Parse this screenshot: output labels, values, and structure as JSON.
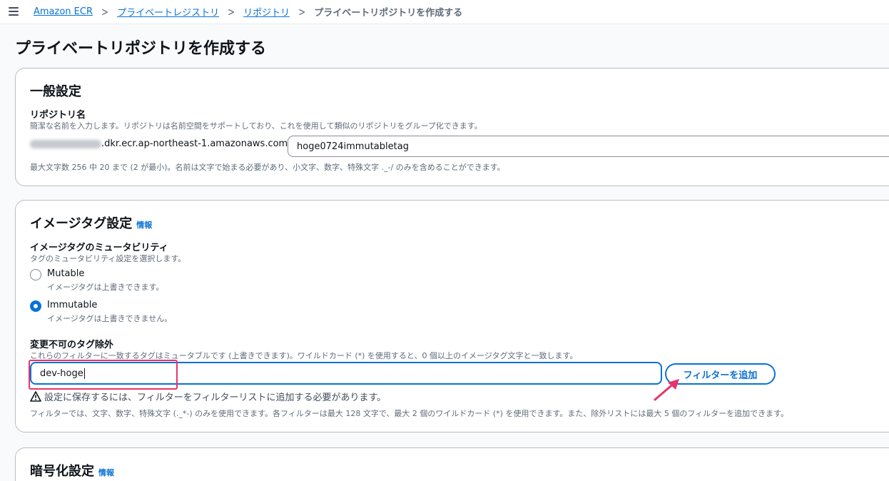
{
  "breadcrumb": {
    "items": [
      "Amazon ECR",
      "プライベートレジストリ",
      "リポジトリ"
    ],
    "current": "プライベートリポジトリを作成する"
  },
  "page": {
    "title": "プライベートリポジトリを作成する"
  },
  "general": {
    "title": "一般設定",
    "repo_name_label": "リポジトリ名",
    "repo_name_desc": "簡潔な名前を入力します。リポジトリは名前空間をサポートしており、これを使用して類似のリポジトリをグループ化できます。",
    "registry_suffix": ".dkr.ecr.ap-northeast-1.amazonaws.com/",
    "repo_name_value": "hoge0724immutabletag",
    "repo_name_constraint": "最大文字数 256 中 20 まで (2 が最小)。名前は文字で始まる必要があり、小文字、数字、特殊文字 ._-/ のみを含めることができます。"
  },
  "image_tag": {
    "title": "イメージタグ設定",
    "info": "情報",
    "mutability_label": "イメージタグのミュータビリティ",
    "mutability_desc": "タグのミュータビリティ設定を選択します。",
    "options": [
      {
        "label": "Mutable",
        "desc": "イメージタグは上書きできます。",
        "checked": false
      },
      {
        "label": "Immutable",
        "desc": "イメージタグは上書きできません。",
        "checked": true
      }
    ],
    "exclusion_label": "変更不可のタグ除外",
    "exclusion_desc": "これらのフィルターに一致するタグはミュータブルです (上書きできます)。ワイルドカード (*) を使用すると、0 個以上のイメージタグ文字と一致します。",
    "filter_value": "dev-hoge",
    "add_filter_button": "フィルターを追加",
    "warning": "設定に保存するには、フィルターをフィルターリストに追加する必要があります。",
    "filter_constraint": "フィルターでは、文字、数字、特殊文字 (._*-) のみを使用できます。各フィルターは最大 128 文字で、最大 2 個のワイルドカード (*) を使用できます。また、除外リストには最大 5 個のフィルターを追加できます。"
  },
  "encryption": {
    "title": "暗号化設定",
    "info": "情報"
  },
  "colors": {
    "link": "#0972d3",
    "highlight": "#e8336e"
  }
}
